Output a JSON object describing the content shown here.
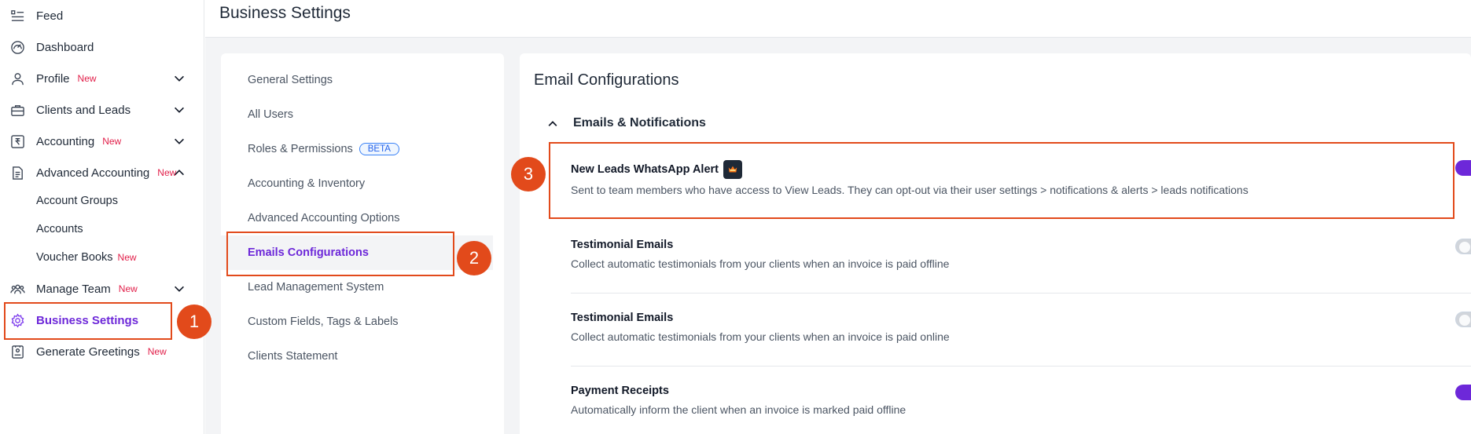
{
  "header": {
    "title": "Business Settings"
  },
  "sidebar": {
    "items": [
      {
        "label": "Feed",
        "badge": ""
      },
      {
        "label": "Dashboard",
        "badge": ""
      },
      {
        "label": "Profile",
        "badge": "New"
      },
      {
        "label": "Clients and Leads",
        "badge": ""
      },
      {
        "label": "Accounting",
        "badge": "New"
      },
      {
        "label": "Advanced Accounting",
        "badge": "New"
      },
      {
        "label": "Account Groups",
        "badge": ""
      },
      {
        "label": "Accounts",
        "badge": ""
      },
      {
        "label": "Voucher Books",
        "badge": "New"
      },
      {
        "label": "Manage Team",
        "badge": "New"
      },
      {
        "label": "Business Settings",
        "badge": ""
      },
      {
        "label": "Generate Greetings",
        "badge": "New"
      }
    ]
  },
  "settings_menu": {
    "items": [
      {
        "label": "General Settings"
      },
      {
        "label": "All Users"
      },
      {
        "label": "Roles & Permissions",
        "tag": "BETA"
      },
      {
        "label": "Accounting & Inventory"
      },
      {
        "label": "Advanced Accounting Options"
      },
      {
        "label": "Emails Configurations"
      },
      {
        "label": "Lead Management System"
      },
      {
        "label": "Custom Fields, Tags & Labels"
      },
      {
        "label": "Clients Statement"
      }
    ]
  },
  "main": {
    "title": "Email Configurations",
    "group_title": "Emails & Notifications",
    "rows": [
      {
        "title": "New Leads WhatsApp Alert",
        "desc": "Sent to team members who have access to View Leads. They can opt-out via their user settings > notifications & alerts > leads notifications",
        "enabled": true
      },
      {
        "title": "Testimonial Emails",
        "desc": "Collect automatic testimonials from your clients when an invoice is paid offline",
        "enabled": false
      },
      {
        "title": "Testimonial Emails",
        "desc": "Collect automatic testimonials from your clients when an invoice is paid online",
        "enabled": false
      },
      {
        "title": "Payment Receipts",
        "desc": "Automatically inform the client when an invoice is marked paid offline",
        "enabled": true
      }
    ]
  },
  "annotations": {
    "step1": "1",
    "step2": "2",
    "step3": "3"
  },
  "colors": {
    "accent": "#6d28d9",
    "annotation": "#e24a1b",
    "new_badge": "#e11d48"
  }
}
